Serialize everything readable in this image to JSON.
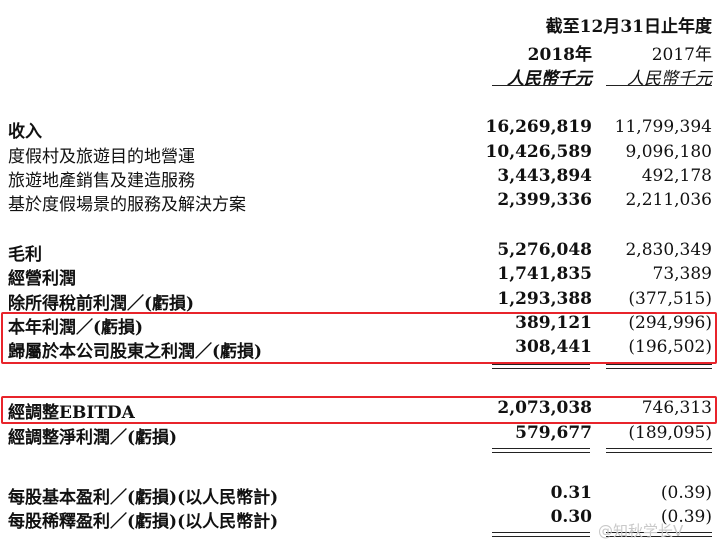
{
  "header": {
    "period": "截至12月31日止年度",
    "col1_year": "2018年",
    "col2_year": "2017年",
    "col1_unit": "人民幣千元",
    "col2_unit": "人民幣千元"
  },
  "rows": [
    {
      "label": "收入",
      "v2018": "16,269,819",
      "v2017": "11,799,394"
    },
    {
      "label": "度假村及旅遊目的地營運",
      "v2018": "10,426,589",
      "v2017": "9,096,180"
    },
    {
      "label": "旅遊地產銷售及建造服務",
      "v2018": "3,443,894",
      "v2017": "492,178"
    },
    {
      "label": "基於度假場景的服務及解決方案",
      "v2018": "2,399,336",
      "v2017": "2,211,036"
    },
    {
      "label": "毛利",
      "v2018": "5,276,048",
      "v2017": "2,830,349"
    },
    {
      "label": "經營利潤",
      "v2018": "1,741,835",
      "v2017": "73,389"
    },
    {
      "label": "除所得稅前利潤／(虧損)",
      "v2018": "1,293,388",
      "v2017": "(377,515)"
    },
    {
      "label": "本年利潤／(虧損)",
      "v2018": "389,121",
      "v2017": "(294,996)"
    },
    {
      "label": "歸屬於本公司股東之利潤／(虧損)",
      "v2018": "308,441",
      "v2017": "(196,502)"
    },
    {
      "label": "經調整EBITDA",
      "v2018": "2,073,038",
      "v2017": "746,313"
    },
    {
      "label": "經調整淨利潤／(虧損)",
      "v2018": "579,677",
      "v2017": "(189,095)"
    },
    {
      "label": "每股基本盈利／(虧損)(以人民幣計)",
      "v2018": "0.31",
      "v2017": "(0.39)"
    },
    {
      "label": "每股稀釋盈利／(虧損)(以人民幣計)",
      "v2018": "0.30",
      "v2017": "(0.39)"
    }
  ],
  "watermark": "@知秋学长V",
  "colors": {
    "highlight": "#e8242b",
    "text": "#111111"
  }
}
